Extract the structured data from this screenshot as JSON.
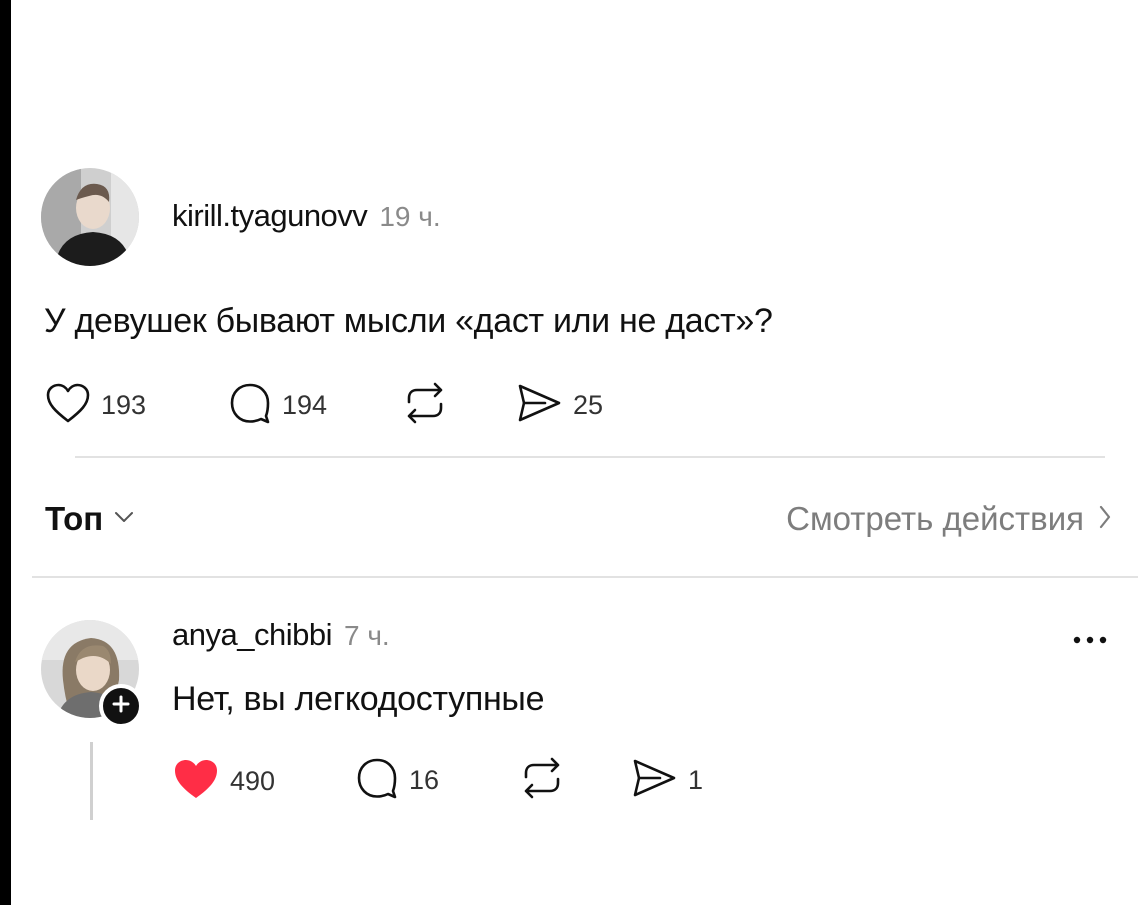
{
  "post": {
    "username": "kirill.tyagunovv",
    "time": "19 ч.",
    "text": "У девушек бывают мысли «даст или не даст»?",
    "likes": "193",
    "comments": "194",
    "shares": "25",
    "icons": [
      "heart-outline-icon",
      "comment-icon",
      "repost-icon",
      "send-icon"
    ]
  },
  "sort": {
    "label": "Топ",
    "activity_link": "Смотреть действия"
  },
  "reply": {
    "username": "anya_chibbi",
    "time": "7 ч.",
    "text": "Нет, вы легкодоступные",
    "likes": "490",
    "comments": "16",
    "shares": "1",
    "liked": true,
    "icons": [
      "heart-filled-icon",
      "comment-icon",
      "repost-icon",
      "send-icon",
      "more-icon",
      "follow-plus-icon"
    ]
  },
  "colors": {
    "like_red": "#ff2d46",
    "text": "#111111",
    "muted": "#8a8a8a",
    "divider": "#e2e2e2"
  }
}
